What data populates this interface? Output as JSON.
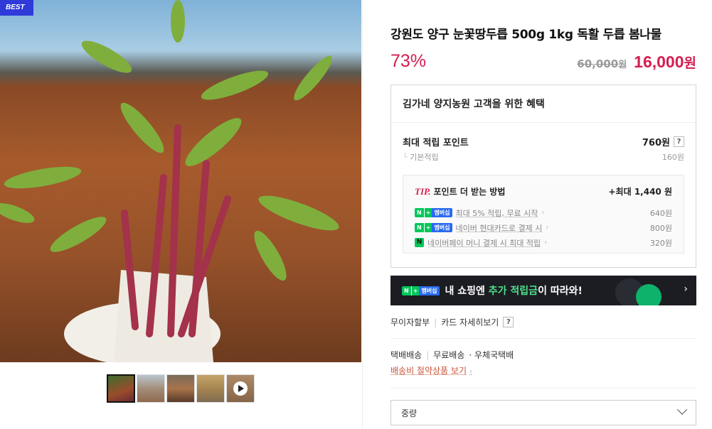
{
  "gallery": {
    "badge": "BEST",
    "thumbnails": [
      "thumb-1",
      "thumb-2",
      "thumb-3",
      "thumb-4",
      "thumb-5-video"
    ]
  },
  "product": {
    "title": "강원도 양구 눈꽃땅두릅 500g 1kg 독활 두릅 봄나물",
    "discount": "73%",
    "original_price": "60,000",
    "original_unit": "원",
    "sale_price": "16,000",
    "sale_unit": "원"
  },
  "benefits": {
    "title": "김가네 양지농원 고객을 위한 혜택",
    "max_point_label": "최대 적립 포인트",
    "max_point_value": "760원",
    "help": "?",
    "base_label": "기본적립",
    "base_value": "160원",
    "tip": {
      "mark": "TIP.",
      "label": "포인트 더 받는 방법",
      "max": "+최대 1,440 원",
      "items": [
        {
          "text": "최대 5% 적립, 무료 시작",
          "value": "640원"
        },
        {
          "text": "네이버 현대카드로 결제 시",
          "value": "800원"
        },
        {
          "text": "네이버페이 머니 결제 시 최대 적립",
          "value": "320원"
        }
      ],
      "badge_n": "N",
      "badge_plus": "+",
      "badge_m": "멤버십",
      "pay_badge": "N"
    }
  },
  "banner": {
    "badge_n": "N",
    "badge_plus": "+",
    "badge_m": "멤버십",
    "text_pre": "내 쇼핑엔 ",
    "text_hl": "추가 적립금",
    "text_post": "이 따라와!",
    "arrow": "›"
  },
  "links": {
    "installment": "무이자할부",
    "card_detail": "카드 자세히보기",
    "help": "?"
  },
  "shipping": {
    "method": "택배배송",
    "fee": "무료배송",
    "carrier": "· 우체국택배",
    "saver_link": "배송비 절약상품 보기"
  },
  "option": {
    "label": "중량"
  },
  "colors": {
    "accent": "#d41e4f",
    "naver_green": "#03c75a",
    "banner_bg": "#1c1d23"
  }
}
